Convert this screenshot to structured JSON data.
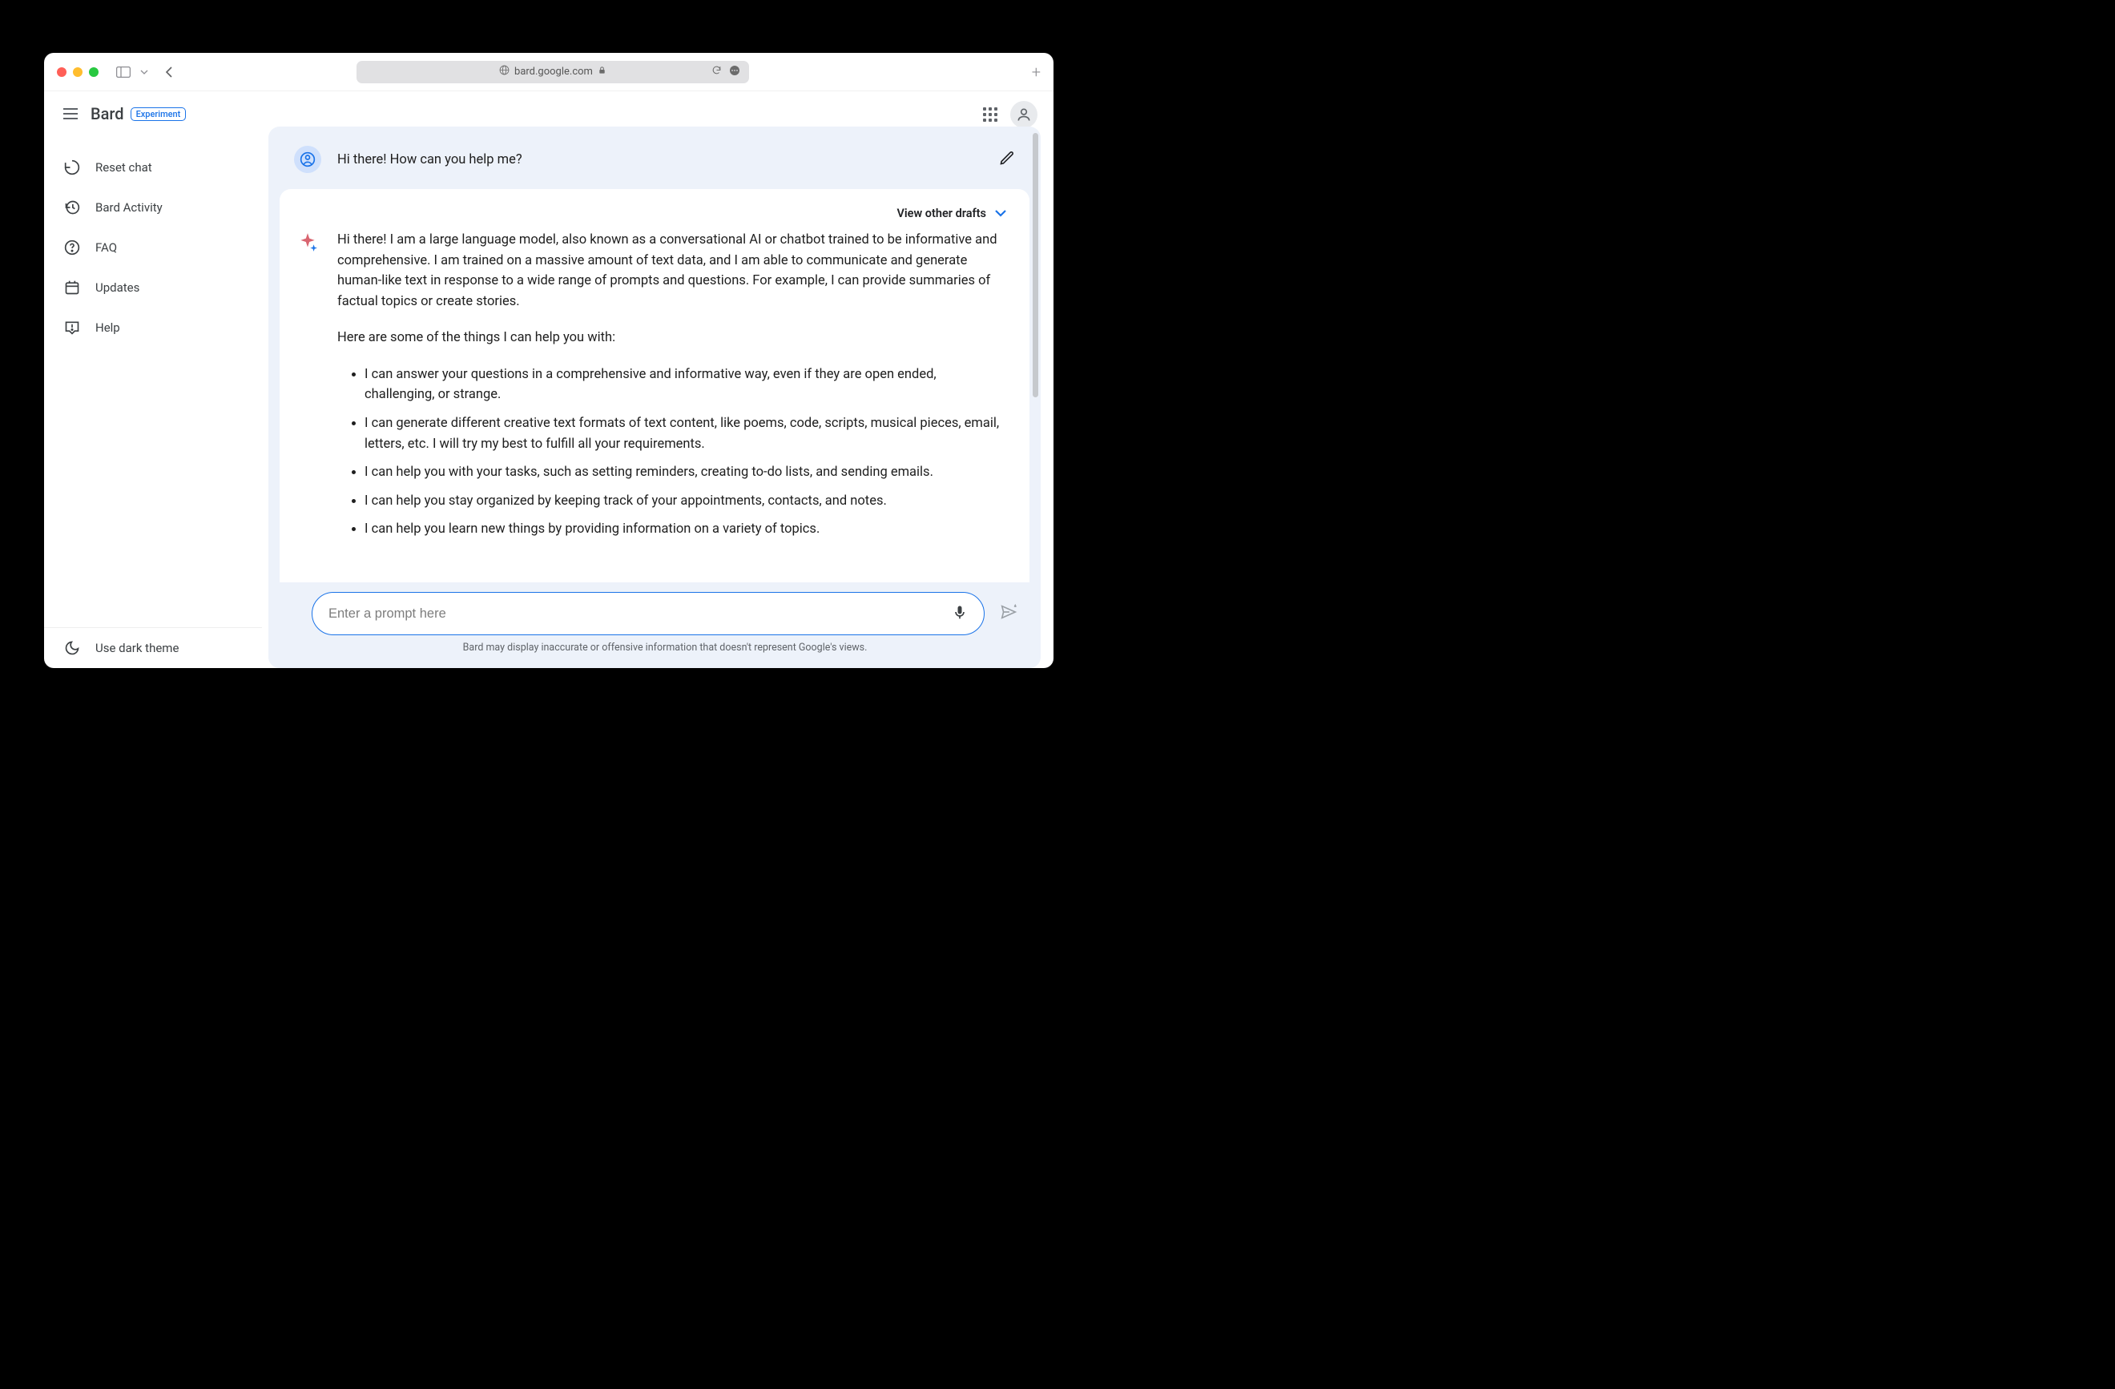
{
  "browser": {
    "url": "bard.google.com"
  },
  "header": {
    "brand_name": "Bard",
    "badge": "Experiment"
  },
  "sidebar": {
    "items": [
      {
        "label": "Reset chat"
      },
      {
        "label": "Bard Activity"
      },
      {
        "label": "FAQ"
      },
      {
        "label": "Updates"
      },
      {
        "label": "Help"
      }
    ],
    "dark_theme_label": "Use dark theme"
  },
  "chat": {
    "user_message": "Hi there! How can you help me?",
    "drafts_label": "View other drafts",
    "response_intro": "Hi there! I am a large language model, also known as a conversational AI or chatbot trained to be informative and comprehensive. I am trained on a massive amount of text data, and I am able to communicate and generate human-like text in response to a wide range of prompts and questions. For example, I can provide summaries of factual topics or create stories.",
    "response_lead": "Here are some of the things I can help you with:",
    "bullets": [
      "I can answer your questions in a comprehensive and informative way, even if they are open ended, challenging, or strange.",
      "I can generate different creative text formats of text content, like poems, code, scripts, musical pieces, email, letters, etc. I will try my best to fulfill all your requirements.",
      "I can help you with your tasks, such as setting reminders, creating to-do lists, and sending emails.",
      "I can help you stay organized by keeping track of your appointments, contacts, and notes.",
      "I can help you learn new things by providing information on a variety of topics."
    ]
  },
  "input": {
    "placeholder": "Enter a prompt here"
  },
  "footer": {
    "disclaimer": "Bard may display inaccurate or offensive information that doesn't represent Google's views."
  }
}
